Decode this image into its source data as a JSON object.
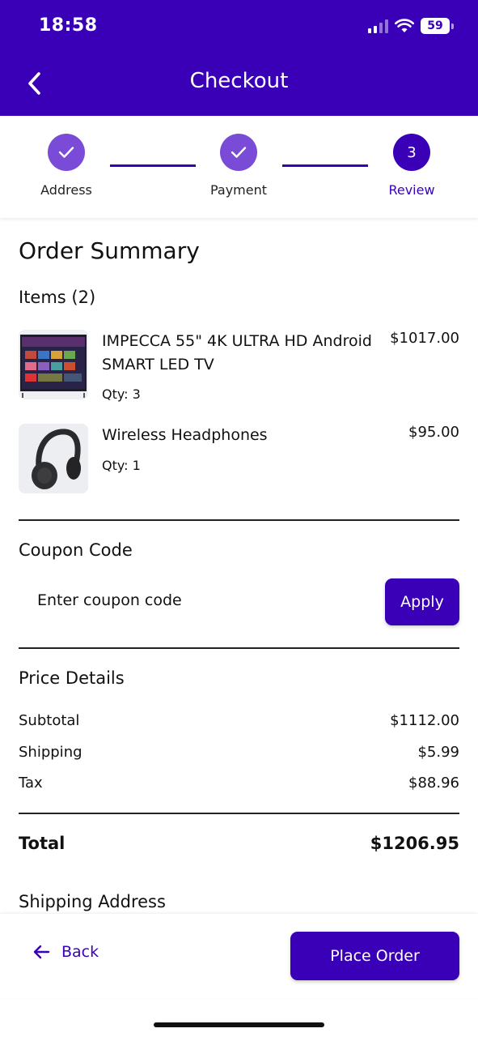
{
  "status_bar": {
    "time": "18:58",
    "battery": "59"
  },
  "header": {
    "title": "Checkout"
  },
  "stepper": {
    "steps": [
      {
        "label": "Address",
        "state": "done"
      },
      {
        "label": "Payment",
        "state": "done"
      },
      {
        "label": "Review",
        "number": "3",
        "state": "active"
      }
    ]
  },
  "summary": {
    "title": "Order Summary",
    "items_heading": "Items (2)",
    "items": [
      {
        "name": "IMPECCA 55\" 4K ULTRA HD Android SMART LED TV",
        "qty": "Qty: 3",
        "price": "$1017.00",
        "icon": "tv-thumbnail"
      },
      {
        "name": "Wireless Headphones",
        "qty": "Qty: 1",
        "price": "$95.00",
        "icon": "headphones-thumbnail"
      }
    ]
  },
  "coupon": {
    "heading": "Coupon Code",
    "placeholder": "Enter coupon code",
    "apply_label": "Apply"
  },
  "price_details": {
    "heading": "Price Details",
    "subtotal_label": "Subtotal",
    "subtotal": "$1112.00",
    "shipping_label": "Shipping",
    "shipping": "$5.99",
    "tax_label": "Tax",
    "tax": "$88.96",
    "total_label": "Total",
    "total": "$1206.95"
  },
  "shipping_address": {
    "heading": "Shipping Address"
  },
  "actions": {
    "back_label": "Back",
    "place_order_label": "Place Order"
  },
  "colors": {
    "primary": "#3A00B8",
    "step_done": "#7A4BD6"
  }
}
